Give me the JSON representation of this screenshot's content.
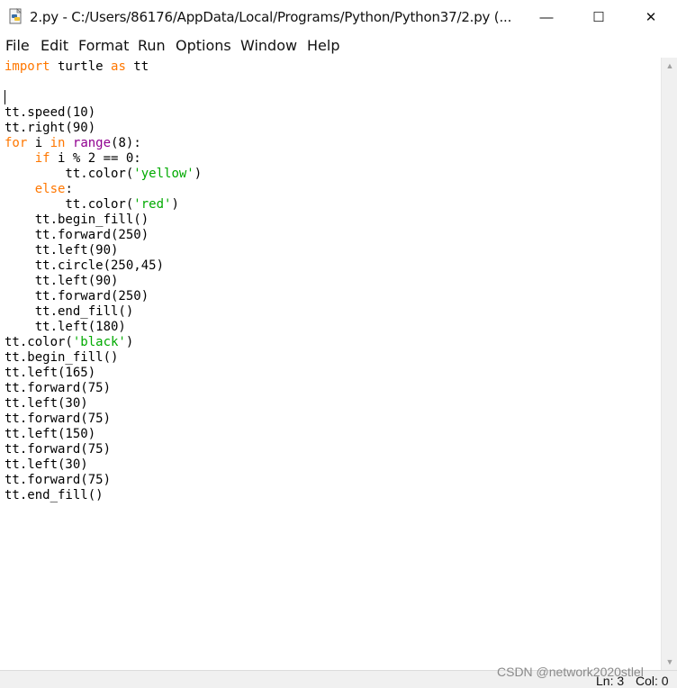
{
  "window": {
    "title": "2.py - C:/Users/86176/AppData/Local/Programs/Python/Python37/2.py (...",
    "app_icon": "python-file-icon",
    "controls": {
      "minimize": "—",
      "maximize": "☐",
      "close": "✕"
    }
  },
  "menu": [
    "File",
    "Edit",
    "Format",
    "Run",
    "Options",
    "Window",
    "Help"
  ],
  "code": [
    "import turtle as tt",
    "",
    "",
    "tt.speed(10)",
    "tt.right(90)",
    "for i in range(8):",
    "    if i % 2 == 0:",
    "        tt.color('yellow')",
    "    else:",
    "        tt.color('red')",
    "    tt.begin_fill()",
    "    tt.forward(250)",
    "    tt.left(90)",
    "    tt.circle(250,45)",
    "    tt.left(90)",
    "    tt.forward(250)",
    "    tt.end_fill()",
    "    tt.left(180)",
    "tt.color('black')",
    "tt.begin_fill()",
    "tt.left(165)",
    "tt.forward(75)",
    "tt.left(30)",
    "tt.forward(75)",
    "tt.left(150)",
    "tt.forward(75)",
    "tt.left(30)",
    "tt.forward(75)",
    "tt.end_fill()"
  ],
  "status": {
    "line": "Ln: 3",
    "col": "Col: 0"
  },
  "watermark": "CSDN @network2020stlel",
  "colors": {
    "keyword": "#ff7700",
    "builtin": "#900090",
    "string": "#00aa00"
  }
}
